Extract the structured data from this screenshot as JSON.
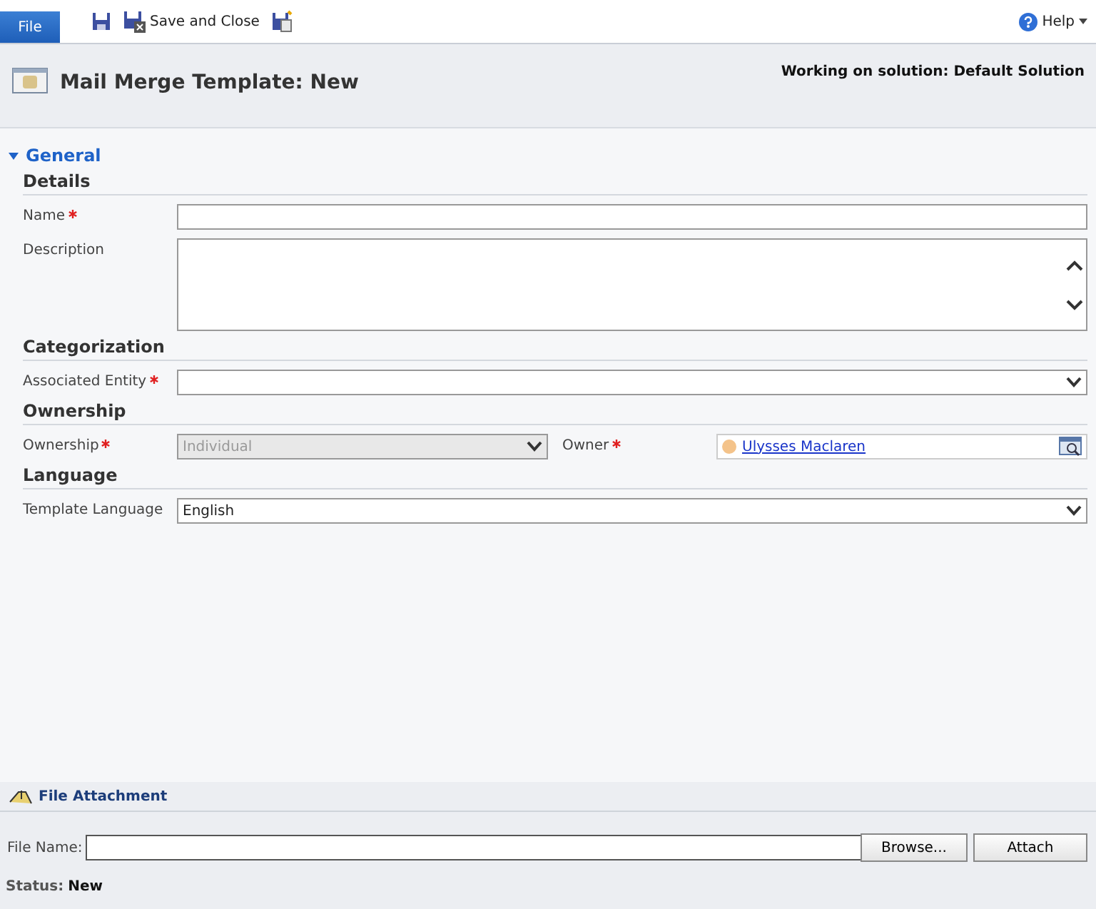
{
  "ribbon": {
    "file_tab": "File",
    "save_close": "Save and Close",
    "help": "Help"
  },
  "header": {
    "title": "Mail Merge Template: New",
    "solution": "Working on solution: Default Solution"
  },
  "tab": {
    "title": "General",
    "expanded": true
  },
  "sections": [
    {
      "title": "Details",
      "rows": [
        [
          {
            "kind": "text",
            "label": "Name",
            "required": true
          }
        ],
        [
          {
            "kind": "textarea",
            "label": "Description",
            "required": false
          }
        ]
      ]
    },
    {
      "title": "Categorization",
      "rows": [
        [
          {
            "kind": "select",
            "label": "Associated Entity",
            "required": true
          }
        ]
      ]
    },
    {
      "title": "Ownership",
      "rows": [
        [
          {
            "kind": "select",
            "label": "Ownership",
            "required": true,
            "value": "Individual",
            "disabled": true
          },
          {
            "kind": "lookup",
            "label": "Owner",
            "required": true,
            "value": "Ulysses Maclaren"
          }
        ]
      ]
    },
    {
      "title": "Language",
      "rows": [
        [
          {
            "kind": "select",
            "label": "Template Language",
            "required": false,
            "value": "English"
          }
        ]
      ]
    }
  ],
  "attachment": {
    "title": "File Attachment",
    "file_label": "File Name:",
    "browse": "Browse...",
    "attach": "Attach"
  },
  "status": {
    "label": "Status:",
    "value": "New"
  }
}
